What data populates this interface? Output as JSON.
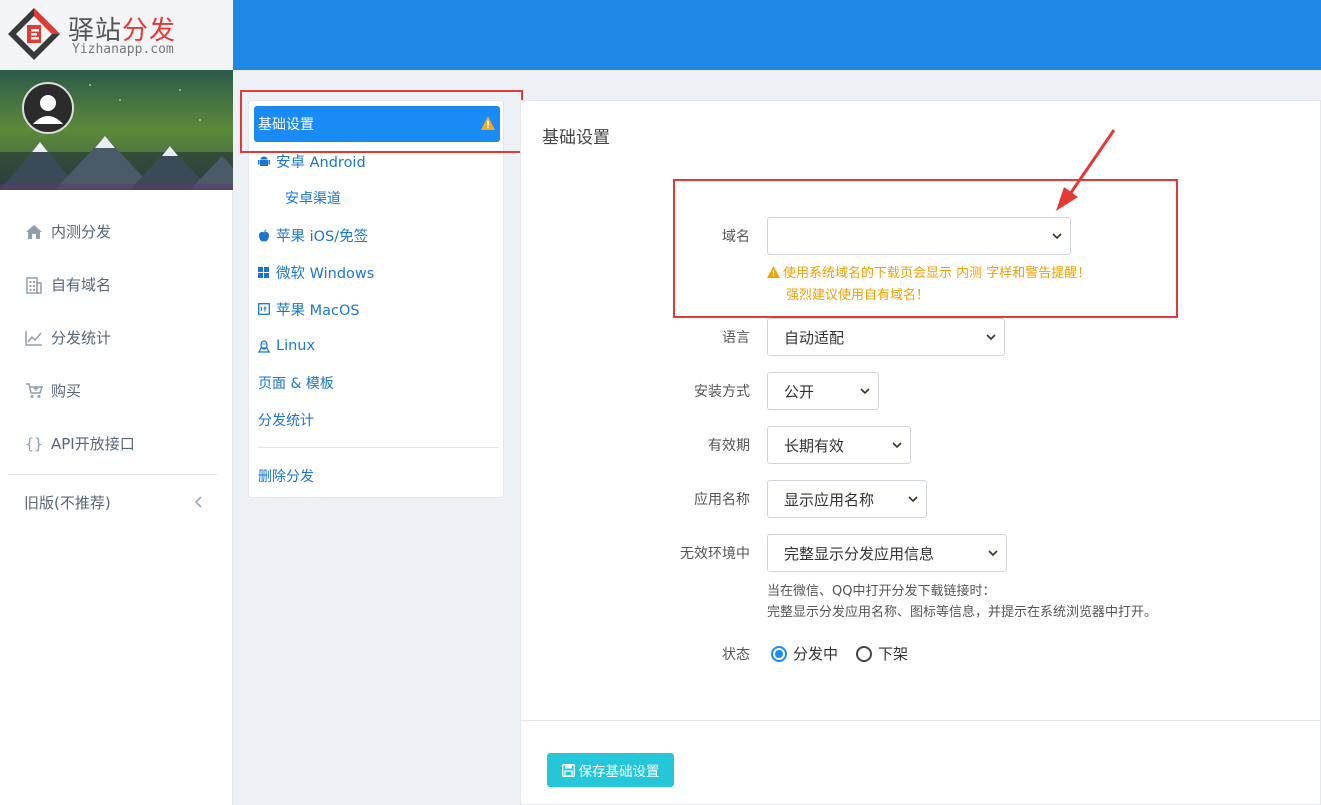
{
  "brand": {
    "name_main": "驿站",
    "name_accent": "分发",
    "domain": "Yizhanapp.com"
  },
  "sidebar": {
    "items": [
      {
        "label": "内测分发",
        "icon": "home-icon"
      },
      {
        "label": "自有域名",
        "icon": "building-icon"
      },
      {
        "label": "分发统计",
        "icon": "chart-line-icon"
      },
      {
        "label": "购买",
        "icon": "cart-icon"
      },
      {
        "label": "API开放接口",
        "icon": "braces-icon"
      }
    ],
    "old_version": "旧版(不推荐)"
  },
  "subnav": {
    "active": "基础设置",
    "items": [
      {
        "label": "安卓 Android",
        "icon": "android-icon"
      },
      {
        "label": "安卓渠道",
        "icon": ""
      },
      {
        "label": "苹果 iOS/免签",
        "icon": "apple-icon"
      },
      {
        "label": "微软 Windows",
        "icon": "windows-icon"
      },
      {
        "label": "苹果 MacOS",
        "icon": "macos-icon"
      },
      {
        "label": "Linux",
        "icon": "linux-icon"
      },
      {
        "label": "页面 & 模板",
        "icon": ""
      },
      {
        "label": "分发统计",
        "icon": ""
      }
    ],
    "delete": "删除分发"
  },
  "form": {
    "title": "基础设置",
    "domain_label": "域名",
    "domain_value": "",
    "domain_warning_1": "使用系统域名的下载页会显示 内测 字样和警告提醒！",
    "domain_warning_2": "强烈建议使用自有域名！",
    "language_label": "语言",
    "language_value": "自动适配",
    "install_label": "安装方式",
    "install_value": "公开",
    "validity_label": "有效期",
    "validity_value": "长期有效",
    "appname_label": "应用名称",
    "appname_value": "显示应用名称",
    "invalid_env_label": "无效环境中",
    "invalid_env_value": "完整显示分发应用信息",
    "invalid_env_help_1": "当在微信、QQ中打开分发下载链接时：",
    "invalid_env_help_2": "完整显示分发应用名称、图标等信息，并提示在系统浏览器中打开。",
    "status_label": "状态",
    "status_options": [
      "分发中",
      "下架"
    ],
    "status_selected": "分发中",
    "save_label": "保存基础设置"
  },
  "colors": {
    "topbar": "#1e88e5",
    "active": "#1a8af5",
    "warning": "#f0a000",
    "save": "#26c6da",
    "highlight": "#e53935"
  }
}
